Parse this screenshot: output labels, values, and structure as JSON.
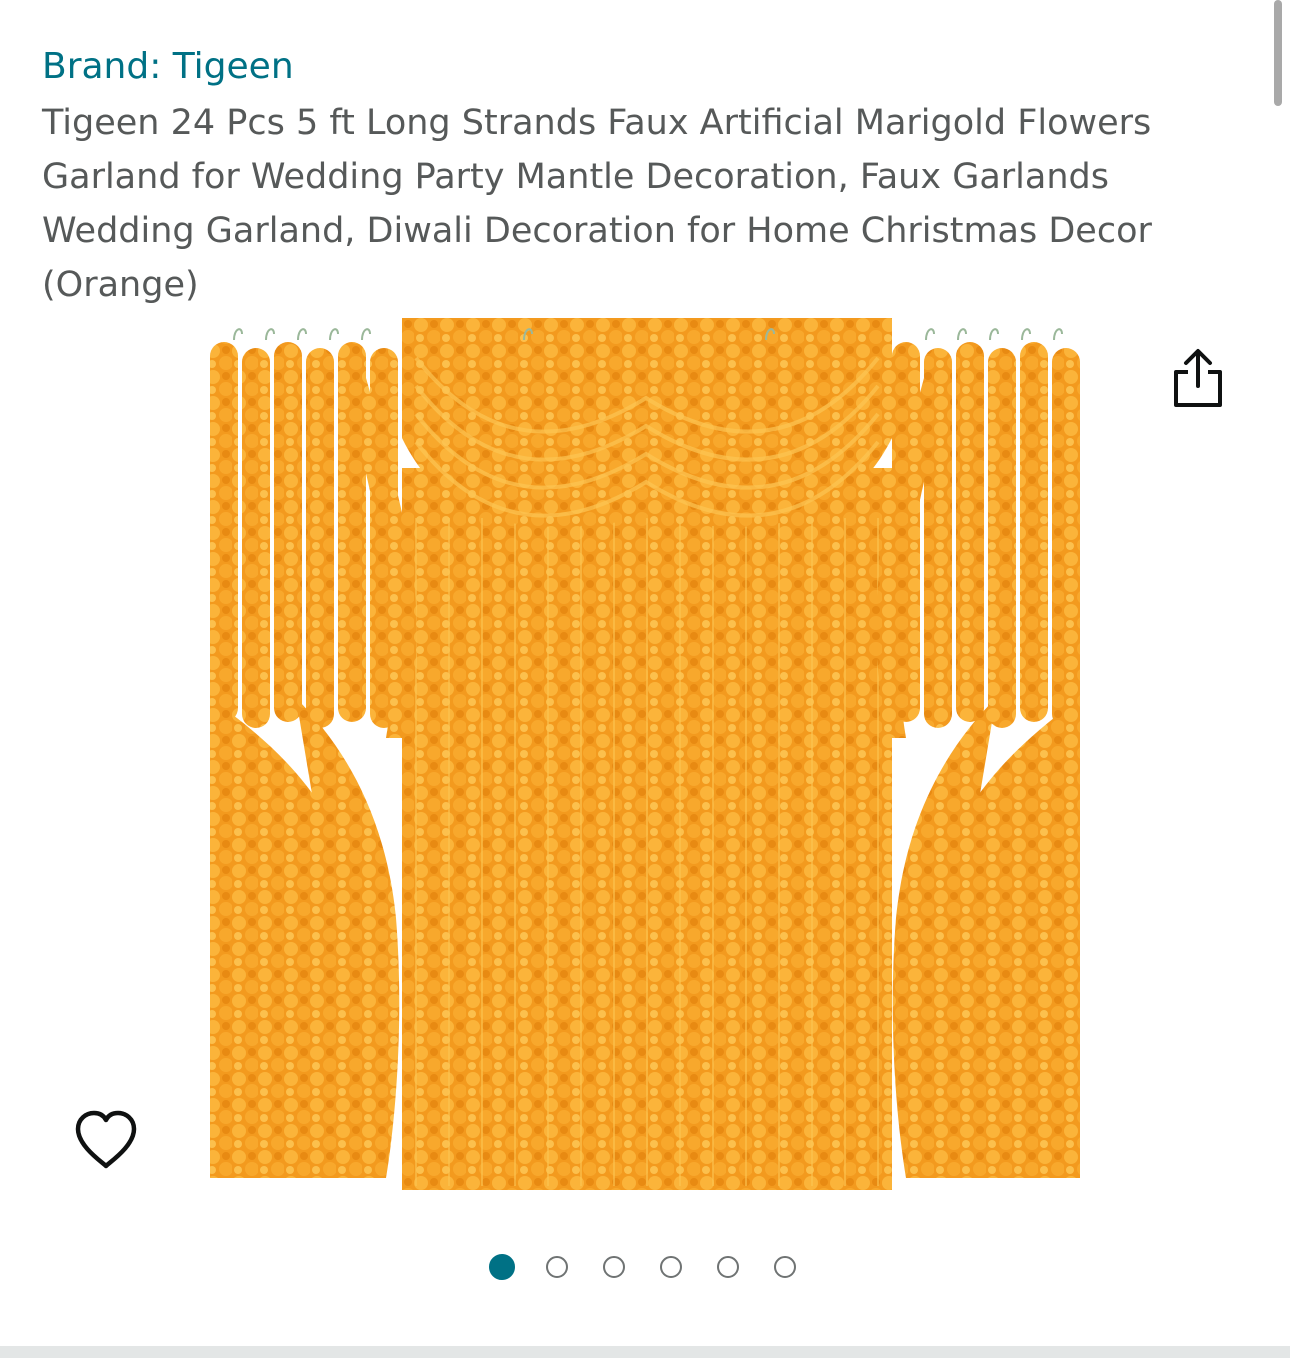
{
  "brand": {
    "label": "Brand: Tigeen"
  },
  "product": {
    "title": "Tigeen 24 Pcs 5 ft Long Strands Faux Artificial Marigold Flowers Garland for Wedding Party Mantle Decoration, Faux Garlands Wedding Garland, Diwali Decoration for Home Christmas Decor (Orange)",
    "image_description_icon": "product-image-marigold-garland-curtain"
  },
  "actions": {
    "share_icon": "share-icon",
    "wishlist_icon": "heart-icon"
  },
  "gallery": {
    "image_count": 6,
    "active_index": 0
  },
  "colors": {
    "link": "#007185",
    "title_text": "#565959",
    "marigold": "#f39a1e",
    "marigold_light": "#fbb73a",
    "dot_inactive": "#6f7373"
  }
}
